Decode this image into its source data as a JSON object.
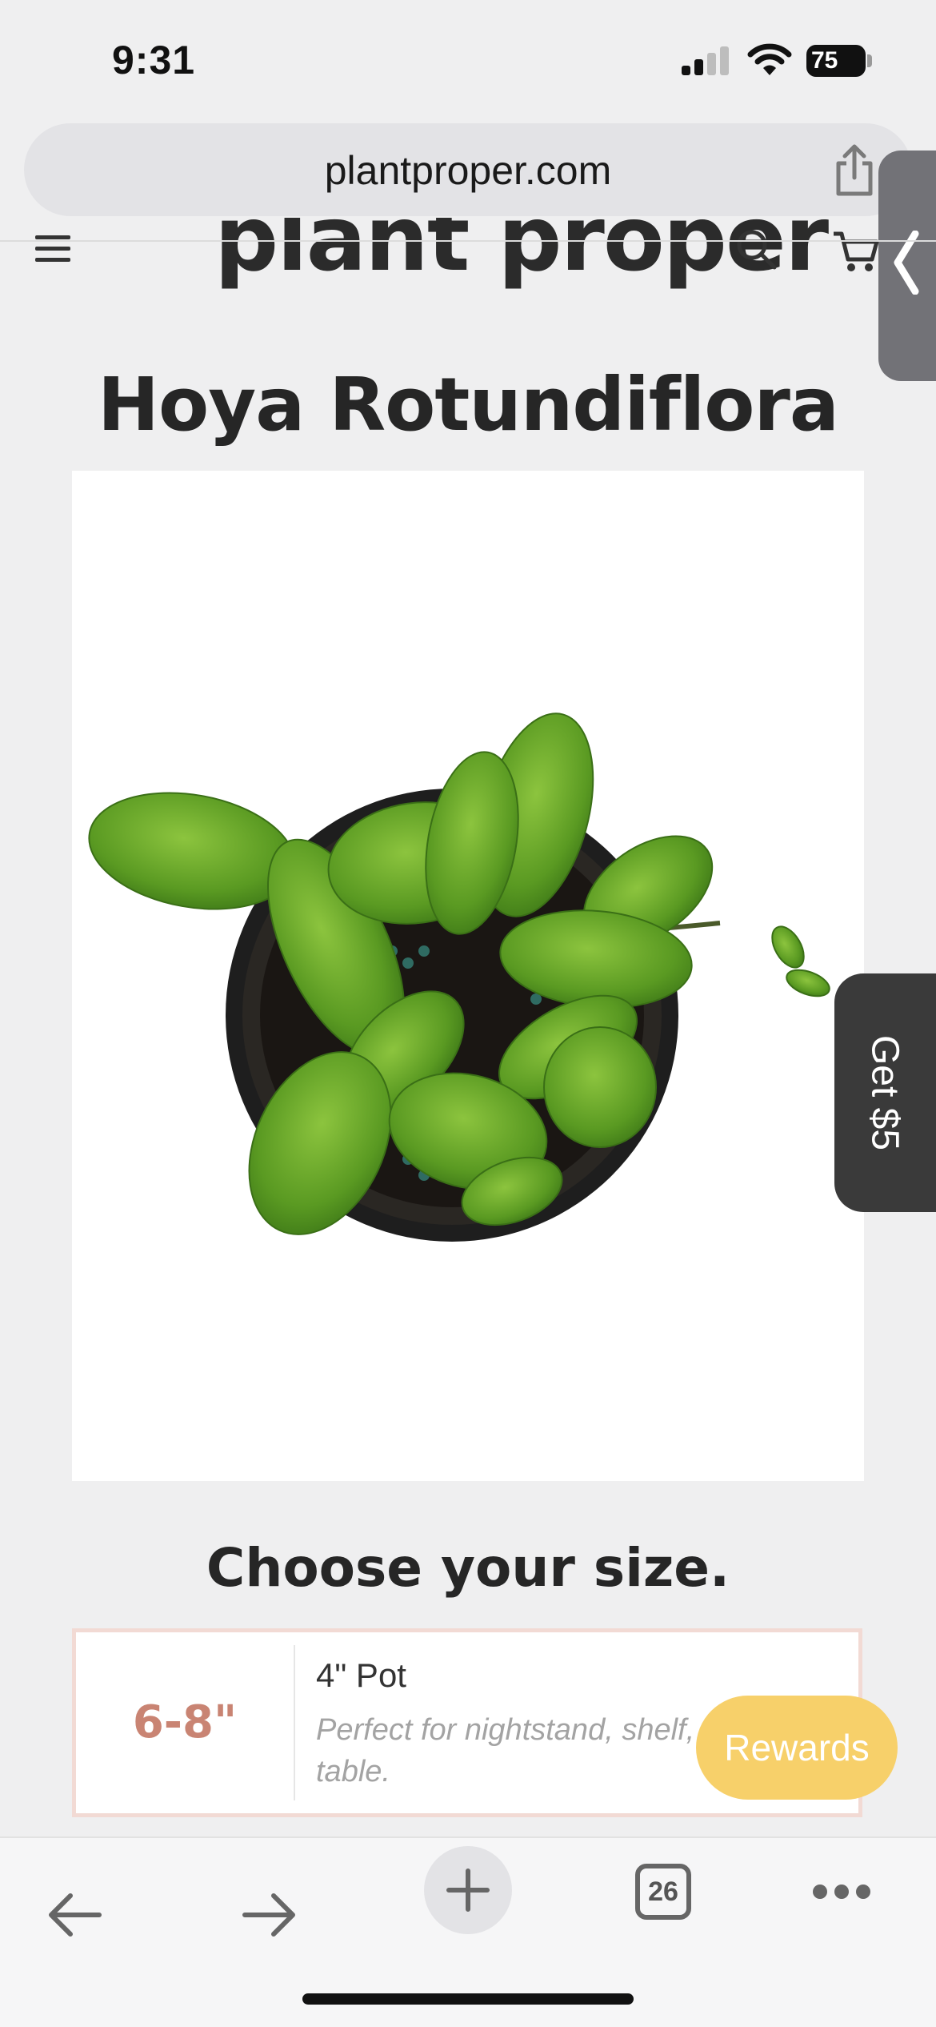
{
  "status_bar": {
    "time": "9:31",
    "battery": "75"
  },
  "browser": {
    "url": "plantproper.com",
    "open_tabs": "26"
  },
  "site": {
    "logo": "plant proper"
  },
  "product": {
    "title": "Hoya Rotundiflora",
    "size_heading": "Choose your size.",
    "size_option": {
      "range": "6-8\"",
      "pot": "4\" Pot",
      "description": "Perfect for nightstand, shelf, table."
    }
  },
  "promos": {
    "get5_label": "Get $5",
    "rewards_label": "Rewards"
  },
  "colors": {
    "accent": "#c98473",
    "rewards": "#f7d06a",
    "card_border": "#f2dad4"
  }
}
